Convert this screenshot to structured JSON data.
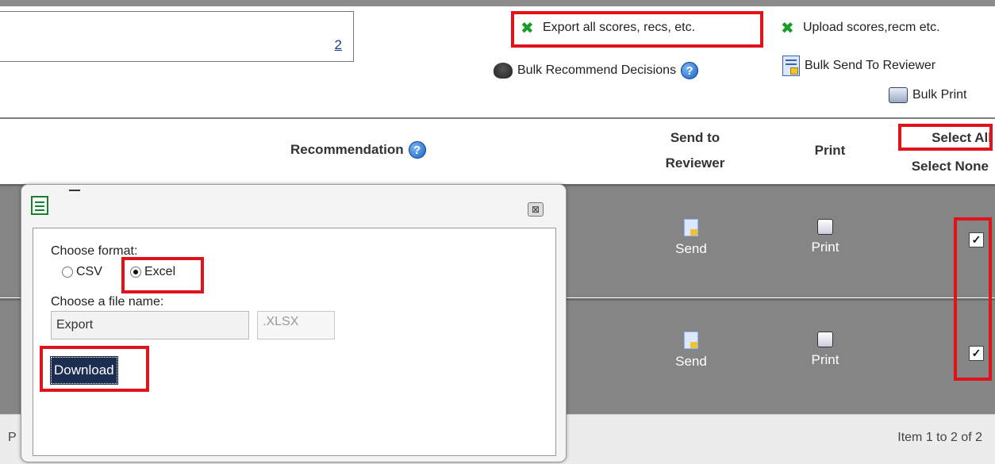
{
  "pager_top": {
    "page_link": "2"
  },
  "actions": {
    "export_all": "Export all scores, recs, etc.",
    "upload_scores": "Upload scores,recm etc.",
    "bulk_recommend": "Bulk Recommend Decisions",
    "bulk_send": "Bulk Send To Reviewer",
    "bulk_print": "Bulk Print"
  },
  "table_header": {
    "recommendation": "Recommendation",
    "send_to": "Send to",
    "reviewer": "Reviewer",
    "print": "Print",
    "select_all": "Select All",
    "select_none": "Select None"
  },
  "rows": [
    {
      "send_label": "Send",
      "print_label": "Print",
      "checked": true
    },
    {
      "send_label": "Send",
      "print_label": "Print",
      "checked": true
    }
  ],
  "footer": {
    "prefix": "P",
    "pager_text": "Item 1 to 2 of 2"
  },
  "dialog": {
    "choose_format_label": "Choose format:",
    "format_options": [
      "CSV",
      "Excel"
    ],
    "selected_format": "Excel",
    "choose_filename_label": "Choose a file name:",
    "filename_value": "Export",
    "extension": ".XLSX",
    "download_label": "Download",
    "close_glyph": "⊠"
  },
  "colors": {
    "highlight": "#e0131a",
    "row_bg": "#858585",
    "download_bg": "#1c2d52",
    "link": "#1a3d8f"
  }
}
